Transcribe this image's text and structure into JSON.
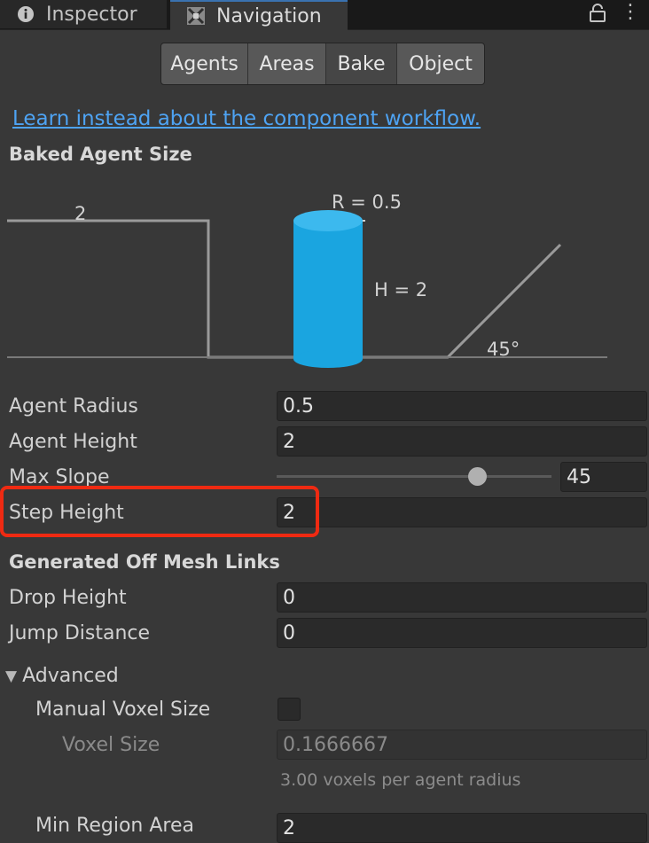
{
  "tabs": [
    {
      "label": "Inspector",
      "icon": "info-icon",
      "active": false
    },
    {
      "label": "Navigation",
      "icon": "navigation-icon",
      "active": true
    }
  ],
  "segments": [
    "Agents",
    "Areas",
    "Bake",
    "Object"
  ],
  "selected_segment": "Bake",
  "link": "Learn instead about the component workflow.",
  "baked_agent_size": {
    "heading": "Baked Agent Size",
    "diagram": {
      "step_label": "2",
      "radius_label": "R = 0.5",
      "height_label": "H = 2",
      "slope_label": "45°"
    }
  },
  "fields": {
    "agent_radius": {
      "label": "Agent Radius",
      "value": "0.5"
    },
    "agent_height": {
      "label": "Agent Height",
      "value": "2"
    },
    "max_slope": {
      "label": "Max Slope",
      "value": "45",
      "slider_fraction": 0.75
    },
    "step_height": {
      "label": "Step Height",
      "value": "2"
    }
  },
  "off_mesh": {
    "heading": "Generated Off Mesh Links",
    "drop_height": {
      "label": "Drop Height",
      "value": "0"
    },
    "jump_distance": {
      "label": "Jump Distance",
      "value": "0"
    }
  },
  "advanced": {
    "label": "Advanced",
    "manual_voxel_size": {
      "label": "Manual Voxel Size",
      "checked": false
    },
    "voxel_size": {
      "label": "Voxel Size",
      "value": "0.1666667"
    },
    "voxel_hint": "3.00 voxels per agent radius",
    "min_region_area": {
      "label": "Min Region Area",
      "value": "2"
    }
  },
  "colors": {
    "agent_cylinder": "#1aa5e0",
    "highlight": "#ef2a12",
    "link": "#4ea3f3"
  }
}
